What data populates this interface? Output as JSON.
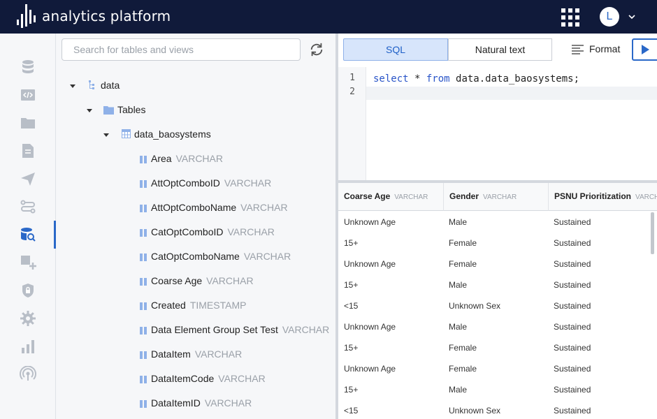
{
  "header": {
    "brand": "analytics platform",
    "avatar_initial": "L"
  },
  "rail": {
    "icons": [
      "database-icon",
      "code-icon",
      "folder-icon",
      "document-icon",
      "send-icon",
      "route-icon",
      "sql-explorer-icon",
      "add-widget-icon",
      "security-icon",
      "settings-icon",
      "bar-chart-icon",
      "broadcast-icon"
    ],
    "active": "sql-explorer-icon"
  },
  "tree": {
    "search_placeholder": "Search for tables and views",
    "root": "data",
    "folder": "Tables",
    "table": "data_baosystems",
    "columns": [
      {
        "name": "Area",
        "type": "VARCHAR"
      },
      {
        "name": "AttOptComboID",
        "type": "VARCHAR"
      },
      {
        "name": "AttOptComboName",
        "type": "VARCHAR"
      },
      {
        "name": "CatOptComboID",
        "type": "VARCHAR"
      },
      {
        "name": "CatOptComboName",
        "type": "VARCHAR"
      },
      {
        "name": "Coarse Age",
        "type": "VARCHAR"
      },
      {
        "name": "Created",
        "type": "TIMESTAMP"
      },
      {
        "name": "Data Element Group Set Test",
        "type": "VARCHAR"
      },
      {
        "name": "DataItem",
        "type": "VARCHAR"
      },
      {
        "name": "DataItemCode",
        "type": "VARCHAR"
      },
      {
        "name": "DataItemID",
        "type": "VARCHAR"
      }
    ]
  },
  "editor": {
    "tabs": [
      "SQL",
      "Natural text"
    ],
    "active_tab": "SQL",
    "format_label": "Format",
    "line_numbers": [
      "1",
      "2"
    ],
    "code": {
      "kw1": "select",
      "star": " * ",
      "kw2": "from",
      "rest": " data.data_baosystems;"
    }
  },
  "results": {
    "columns": [
      {
        "name": "Coarse Age",
        "type": "VARCHAR"
      },
      {
        "name": "Gender",
        "type": "VARCHAR"
      },
      {
        "name": "PSNU Prioritization",
        "type": "VARCHAR"
      }
    ],
    "rows": [
      [
        "Unknown Age",
        "Male",
        "Sustained"
      ],
      [
        "15+",
        "Female",
        "Sustained"
      ],
      [
        "Unknown Age",
        "Female",
        "Sustained"
      ],
      [
        "15+",
        "Male",
        "Sustained"
      ],
      [
        "<15",
        "Unknown Sex",
        "Sustained"
      ],
      [
        "Unknown Age",
        "Male",
        "Sustained"
      ],
      [
        "15+",
        "Female",
        "Sustained"
      ],
      [
        "Unknown Age",
        "Female",
        "Sustained"
      ],
      [
        "15+",
        "Male",
        "Sustained"
      ],
      [
        "<15",
        "Unknown Sex",
        "Sustained"
      ]
    ]
  },
  "colors": {
    "topbar": "#101a3a",
    "accent": "#2a68c8",
    "tab_active_bg": "#d7e5fb",
    "column_icon": "#8fb1e8"
  }
}
